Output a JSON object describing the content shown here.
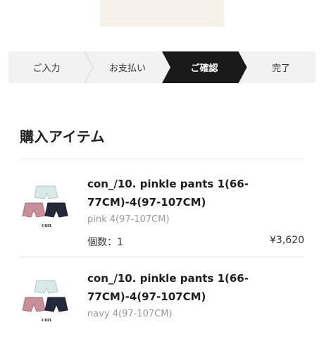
{
  "steps": [
    {
      "label": "ご入力",
      "active": false
    },
    {
      "label": "お支払い",
      "active": false
    },
    {
      "label": "ご確認",
      "active": true
    },
    {
      "label": "完了",
      "active": false
    }
  ],
  "section_title": "購入アイテム",
  "items": [
    {
      "name_line1": "con_/10. pinkle pants 1(66-",
      "name_line2": "77CM)-4(97-107CM)",
      "variant": "pink 4(97-107CM)",
      "qty": "個数：1",
      "price": "¥3,620",
      "thumb_brand": "con"
    },
    {
      "name_line1": "con_/10. pinkle pants 1(66-",
      "name_line2": "77CM)-4(97-107CM)",
      "variant": "navy 4(97-107CM)",
      "thumb_brand": "con"
    }
  ],
  "colors": {
    "stepper_bg": "#f2f2f2",
    "step_active_bg": "#1a1a1a",
    "banner_bg": "#f6f1ea",
    "pink": "#c98f99",
    "navy": "#232a3a",
    "mint": "#d9eae6"
  }
}
